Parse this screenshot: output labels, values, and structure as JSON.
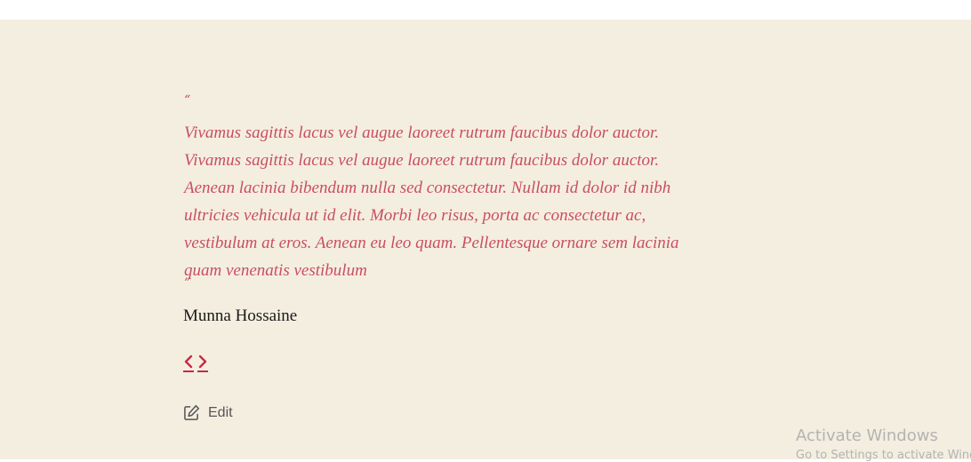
{
  "testimonial": {
    "open_mark": "“",
    "text": "Vivamus sagittis lacus vel augue laoreet rutrum faucibus dolor auctor. Vivamus sagittis lacus vel augue laoreet rutrum faucibus dolor auctor. Aenean lacinia bibendum nulla sed consectetur. Nullam id dolor id nibh ultricies vehicula ut id elit. Morbi leo risus, porta ac consectetur ac, vestibulum at eros. Aenean eu leo quam. Pellentesque ornare sem lacinia quam venenatis vestibulum",
    "close_mark": "”",
    "author": "Munna Hossaine"
  },
  "navigation": {
    "prev_icon": "chevron-left-icon",
    "next_icon": "chevron-right-icon"
  },
  "edit": {
    "label": "Edit",
    "icon": "edit-icon"
  },
  "watermark": {
    "title": "Activate Windows",
    "subtitle": "Go to Settings to activate Windows."
  },
  "colors": {
    "background": "#f4eee0",
    "accent": "#c8294a",
    "quote_text": "#c94e62"
  }
}
